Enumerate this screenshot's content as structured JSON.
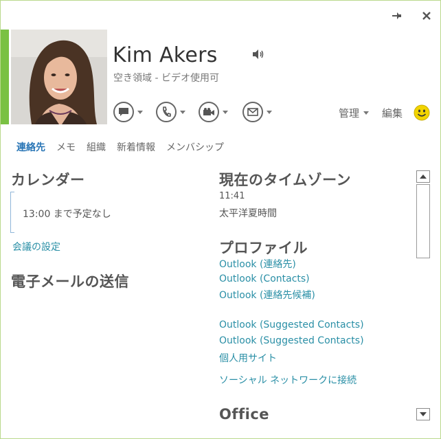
{
  "contact": {
    "name": "Kim Akers",
    "status": "空き領域 - ビデオ使用可"
  },
  "window": {
    "pin_icon": "pin-icon",
    "close_icon": "close-icon"
  },
  "actions": {
    "im_icon": "chat-bubble-icon",
    "call_icon": "phone-icon",
    "video_icon": "video-camera-icon",
    "email_icon": "envelope-icon",
    "manage_label": "管理",
    "edit_label": "編集",
    "smiley_icon": "smiley-icon"
  },
  "tabs": [
    {
      "label": "連絡先",
      "active": true
    },
    {
      "label": "メモ"
    },
    {
      "label": "組織"
    },
    {
      "label": "新着情報"
    },
    {
      "label": "メンバシップ"
    }
  ],
  "left": {
    "calendar_heading": "カレンダー",
    "calendar_text": "13:00 まで予定なし",
    "meeting_link": "会議の設定",
    "email_heading": "電子メールの送信"
  },
  "right": {
    "timezone_heading": "現在のタイムゾーン",
    "time": "11:41",
    "timezone_name": "太平洋夏時間",
    "profile_heading": "プロファイル",
    "profile_links": [
      "Outlook (連絡先)",
      "Outlook (Contacts)",
      "Outlook (連絡先候補)",
      "Outlook (Suggested Contacts)",
      "Outlook (Suggested Contacts)",
      "個人用サイト",
      "ソーシャル ネットワークに接続"
    ],
    "office_heading": "Office"
  },
  "colors": {
    "presence": "#7ac143",
    "link": "#2a8fa6",
    "active_tab": "#2a76b6",
    "smiley": "#f2d400"
  }
}
